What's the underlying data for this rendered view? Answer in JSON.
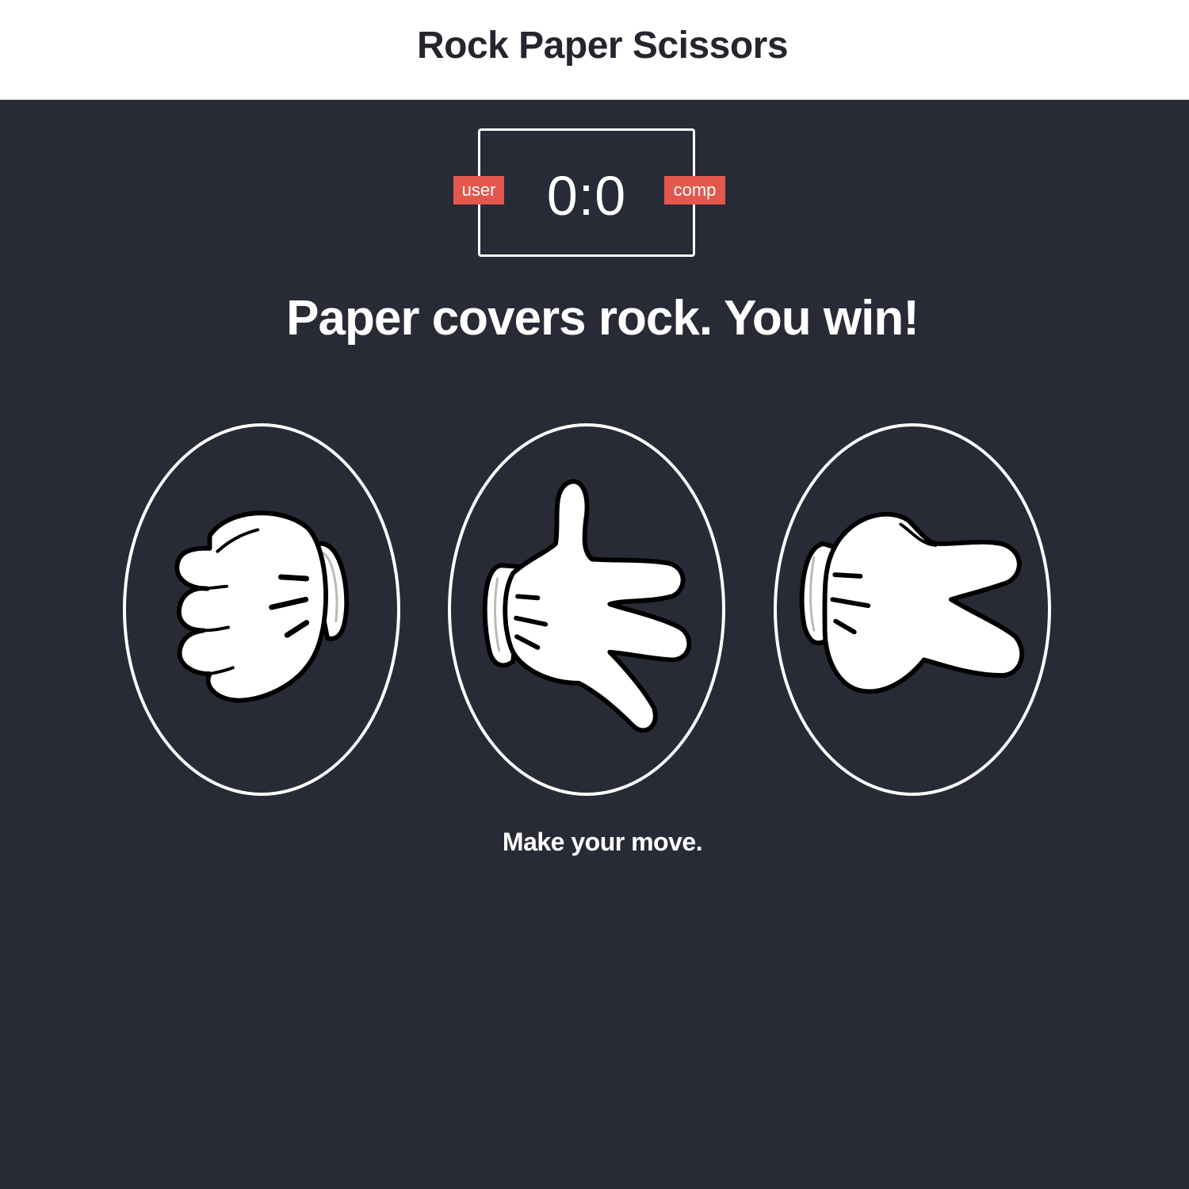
{
  "header": {
    "title": "Rock Paper Scissors"
  },
  "scoreboard": {
    "user_label": "user",
    "comp_label": "comp",
    "score": "0:0",
    "user_score": 0,
    "comp_score": 0
  },
  "result": {
    "message": "Paper covers rock. You win!"
  },
  "choices": [
    {
      "id": "rock",
      "icon": "rock-hand-icon"
    },
    {
      "id": "paper",
      "icon": "paper-hand-icon"
    },
    {
      "id": "scissors",
      "icon": "scissors-hand-icon"
    }
  ],
  "action": {
    "message": "Make your move."
  },
  "colors": {
    "background": "#282a35",
    "header": "#ffffff",
    "badge": "#e2584d",
    "text": "#ffffff",
    "title": "#24262f"
  }
}
